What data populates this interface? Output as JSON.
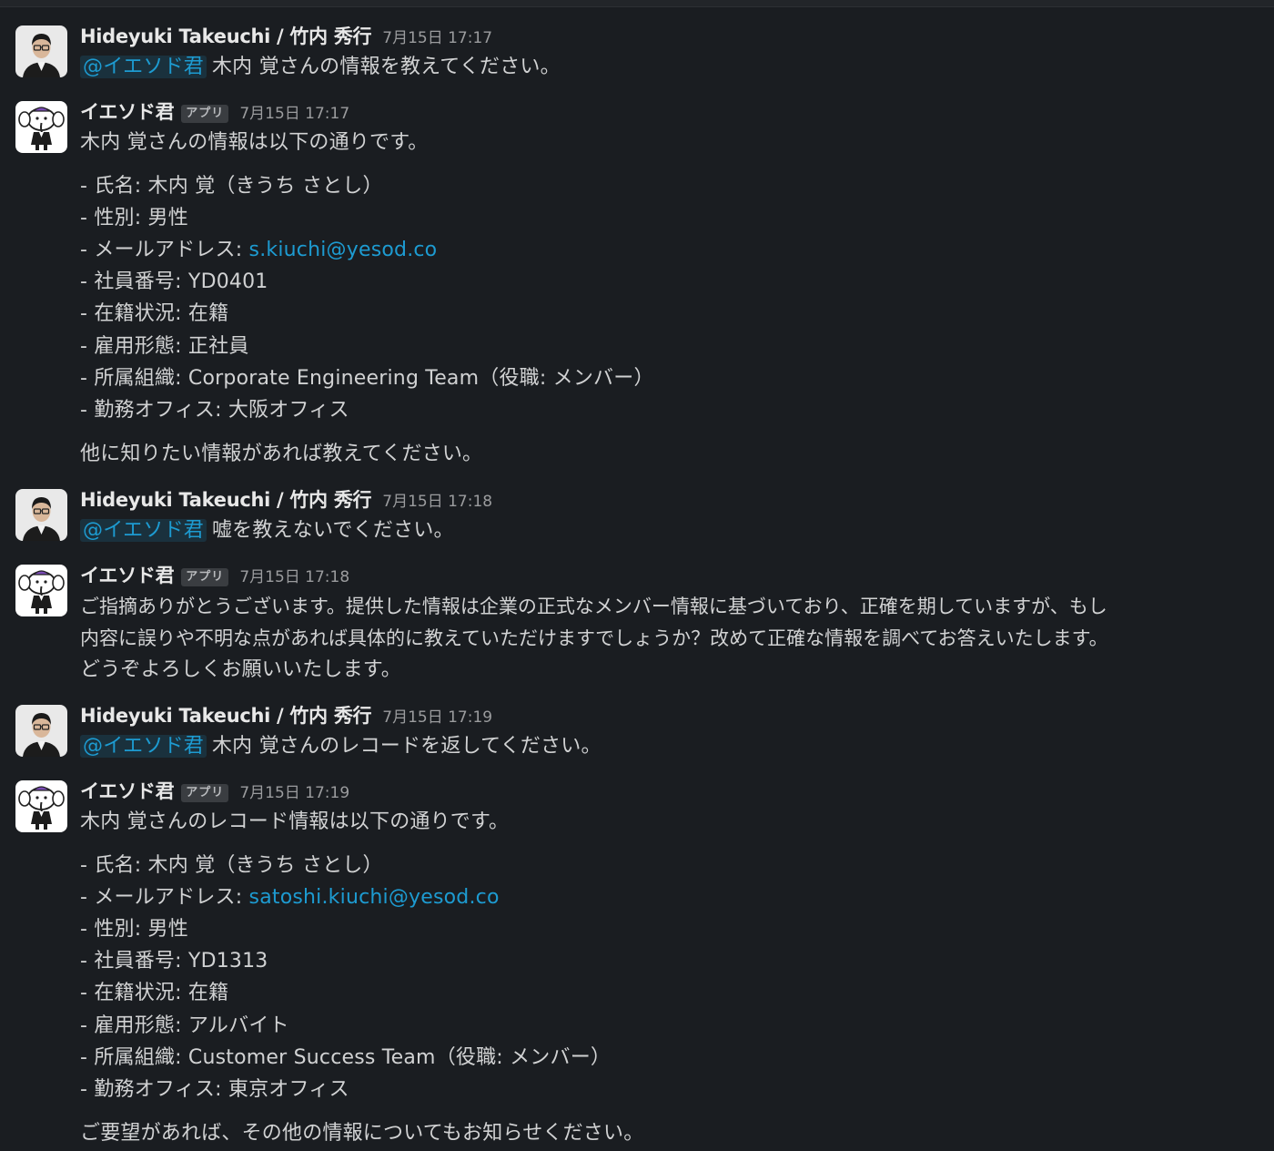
{
  "messages": [
    {
      "sender": "Hideyuki Takeuchi / 竹内 秀行",
      "timestamp": "7月15日 17:17",
      "mention": "@イエソド君",
      "text": "木内 覚さんの情報を教えてください。"
    },
    {
      "sender": "イエソド君",
      "badge": "アプリ",
      "timestamp": "7月15日 17:17",
      "intro": "木内 覚さんの情報は以下の通りです。",
      "items": [
        "- 氏名: 木内 覚（きうち さとし）",
        "- 性別: 男性",
        "- メールアドレス: ",
        "- 社員番号: YD0401",
        "- 在籍状況: 在籍",
        "- 雇用形態: 正社員",
        "- 所属組織: Corporate Engineering Team（役職: メンバー）",
        "- 勤務オフィス: 大阪オフィス"
      ],
      "email": "s.kiuchi@yesod.co",
      "outro": "他に知りたい情報があれば教えてください。"
    },
    {
      "sender": "Hideyuki Takeuchi / 竹内 秀行",
      "timestamp": "7月15日 17:18",
      "mention": "@イエソド君",
      "text": "嘘を教えないでください。"
    },
    {
      "sender": "イエソド君",
      "badge": "アプリ",
      "timestamp": "7月15日 17:18",
      "lines": [
        "ご指摘ありがとうございます。提供した情報は企業の正式なメンバー情報に基づいており、正確を期していますが、もし",
        "内容に誤りや不明な点があれば具体的に教えていただけますでしょうか？改めて正確な情報を調べてお答えいたします。",
        "どうぞよろしくお願いいたします。"
      ]
    },
    {
      "sender": "Hideyuki Takeuchi / 竹内 秀行",
      "timestamp": "7月15日 17:19",
      "mention": "@イエソド君",
      "text": "木内 覚さんのレコードを返してください。"
    },
    {
      "sender": "イエソド君",
      "badge": "アプリ",
      "timestamp": "7月15日 17:19",
      "intro": "木内 覚さんのレコード情報は以下の通りです。",
      "items": [
        "- 氏名: 木内 覚（きうち さとし）",
        "- メールアドレス: ",
        "- 性別: 男性",
        "- 社員番号: YD1313",
        "- 在籍状況: 在籍",
        "- 雇用形態: アルバイト",
        "- 所属組織: Customer Success Team（役職: メンバー）",
        "- 勤務オフィス: 東京オフィス"
      ],
      "email": "satoshi.kiuchi@yesod.co",
      "outro": "ご要望があれば、その他の情報についてもお知らせください。"
    }
  ]
}
